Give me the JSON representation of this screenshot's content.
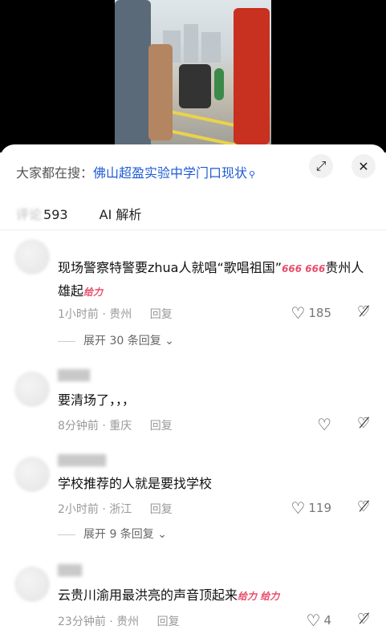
{
  "search": {
    "prefix": "大家都在搜：",
    "query": "佛山超盈实验中学门口现状",
    "glass": "⚲"
  },
  "tabs": {
    "comments_count": "593",
    "ai_label": "AI 解析"
  },
  "icons": {
    "expand": "⤢",
    "close": "✕",
    "heart": "♡",
    "dislike": "♡̸"
  },
  "comments": [
    {
      "text": "现场警察特警要zhua人就唱“歌唱祖国”",
      "emojis": "666 666",
      "text2": "贵州人雄起",
      "emoji2": "给力",
      "time": "1小时前",
      "loc": "贵州",
      "reply": "回复",
      "likes": "185",
      "expand": "展开 30 条回复"
    },
    {
      "text": "要清场了，，，",
      "time": "8分钟前",
      "loc": "重庆",
      "reply": "回复"
    },
    {
      "text": "学校推荐的人就是要找学校",
      "time": "2小时前",
      "loc": "浙江",
      "reply": "回复",
      "likes": "119",
      "expand": "展开 9 条回复"
    },
    {
      "text": "云贵川渝用最洪亮的声音顶起来",
      "emoji": "给力 给力",
      "time": "23分钟前",
      "loc": "贵州",
      "reply": "回复",
      "likes": "4"
    }
  ]
}
